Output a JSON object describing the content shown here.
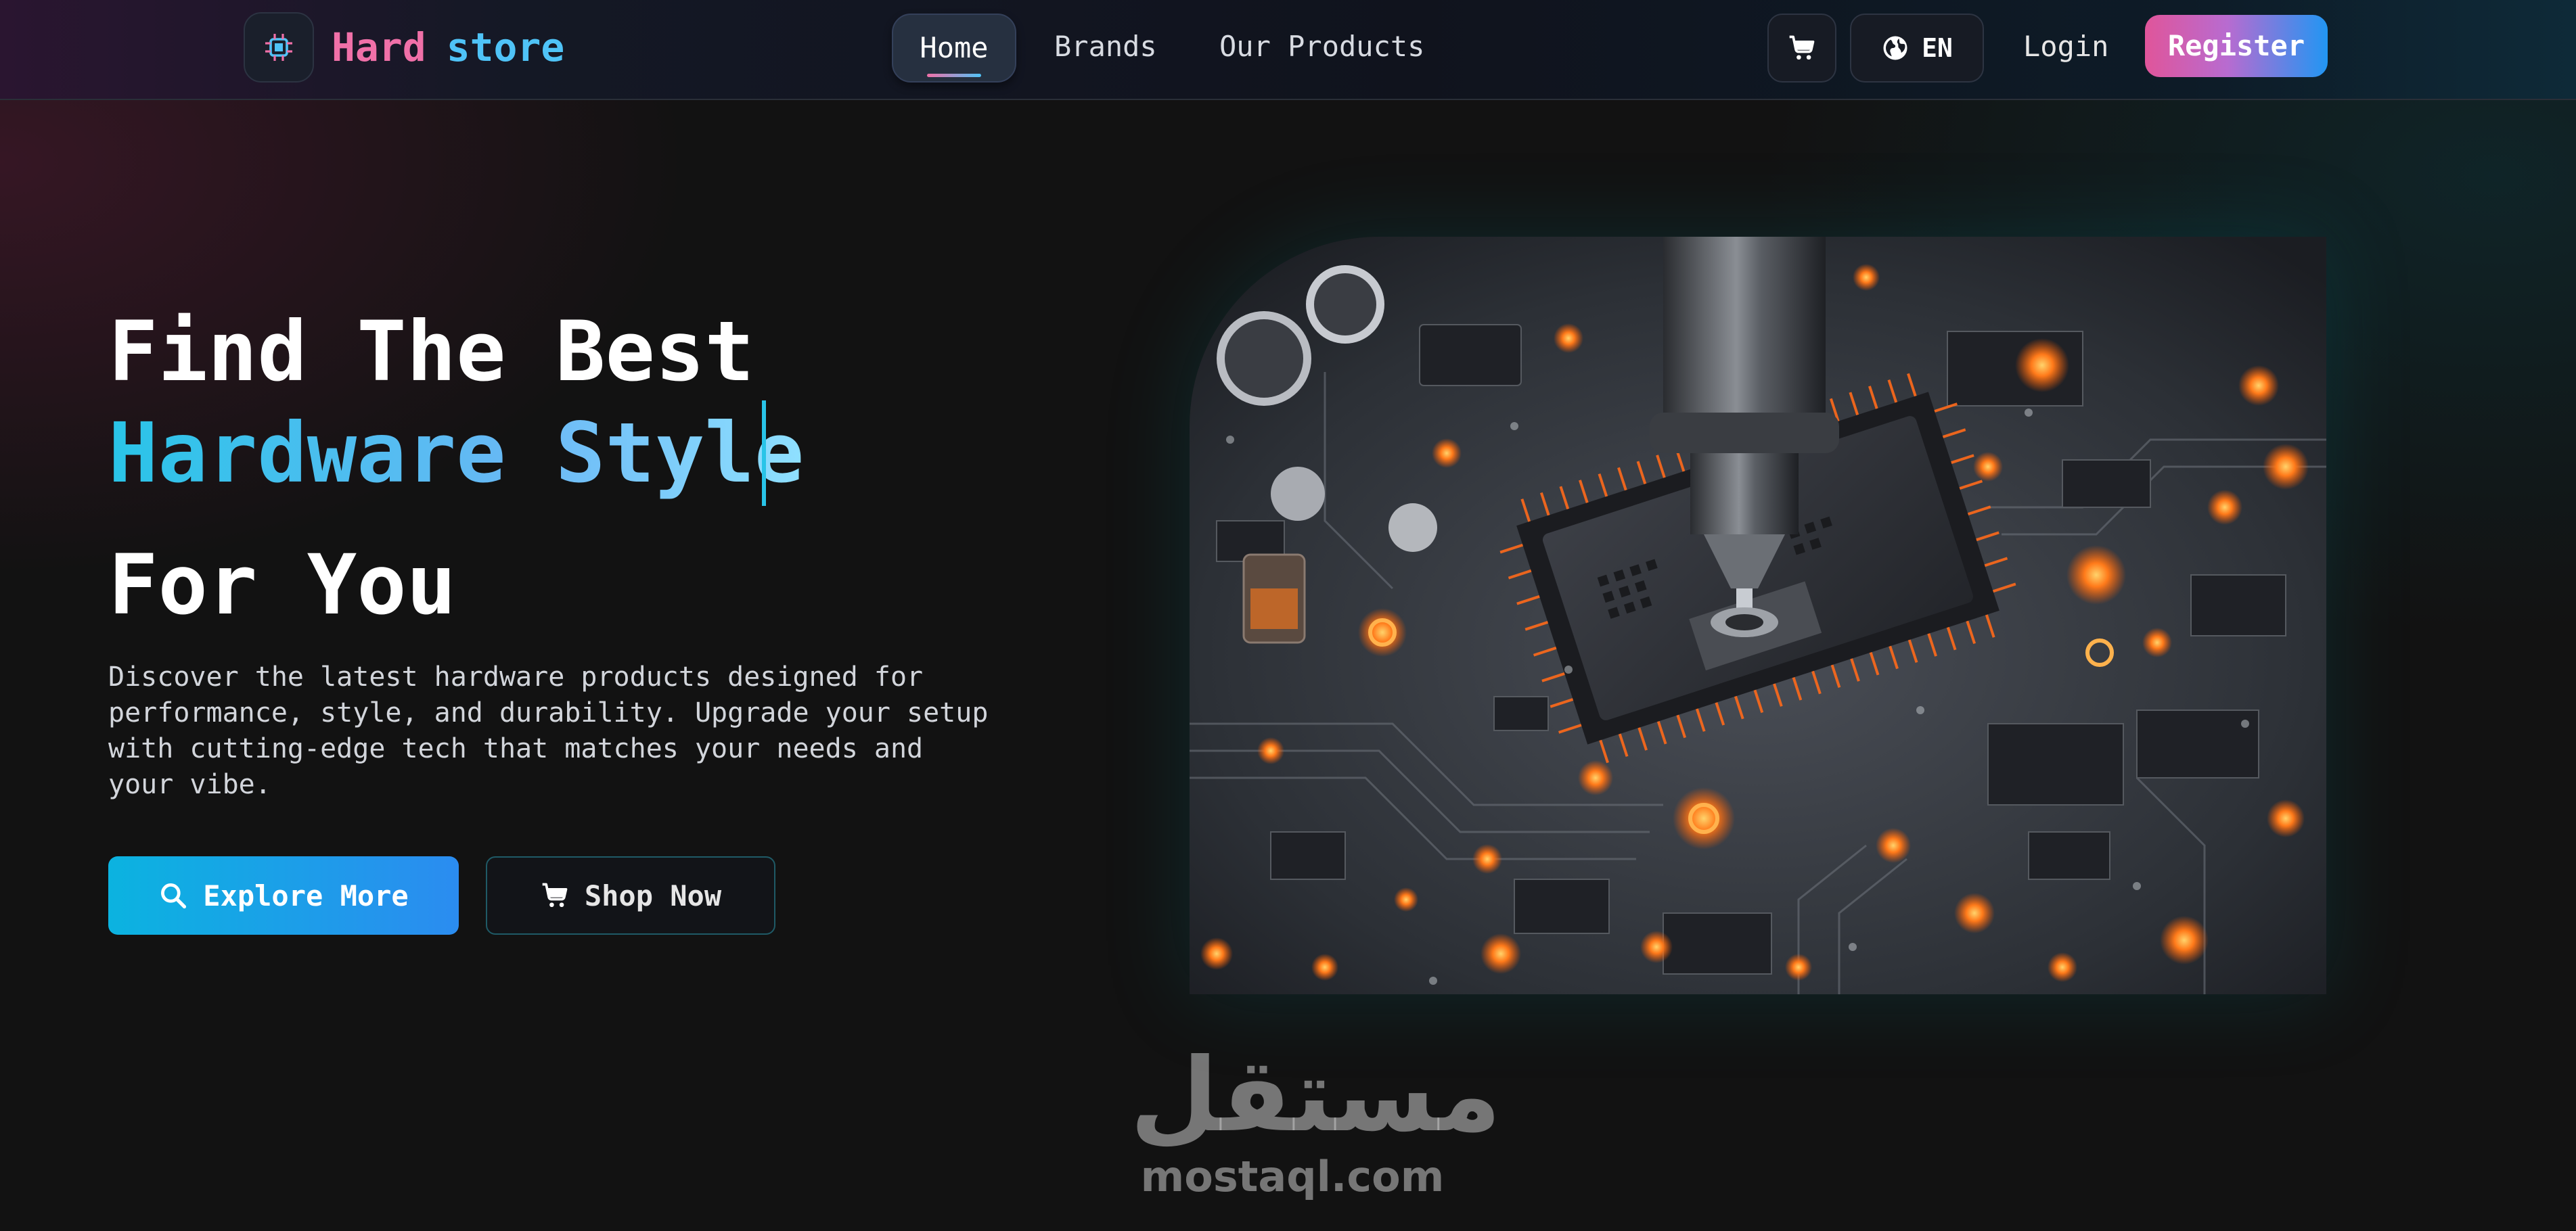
{
  "brand": {
    "part1": "Hard",
    "part2": "store"
  },
  "nav": {
    "home": "Home",
    "brands": "Brands",
    "products": "Our Products"
  },
  "header_actions": {
    "language": "EN",
    "login": "Login",
    "register": "Register"
  },
  "hero": {
    "title_line1": "Find The Best",
    "title_line2": "Hardware Style",
    "title_line3": "For You",
    "description": "Discover the latest hardware products designed for performance, style, and durability. Upgrade your setup with cutting-edge tech that matches your needs and your vibe.",
    "explore_label": "Explore More",
    "shop_label": "Shop Now"
  },
  "watermark": {
    "arabic": "مستقل",
    "latin": "mostaql.com"
  },
  "colors": {
    "pink": "#f070a8",
    "cyan": "#4fc3f7",
    "accent_blue": "#2b8cf0",
    "background": "#121212"
  },
  "icons": {
    "logo": "cpu-chip-icon",
    "cart": "cart-icon",
    "language": "globe-icon",
    "explore": "search-icon",
    "shop": "cart-icon"
  }
}
